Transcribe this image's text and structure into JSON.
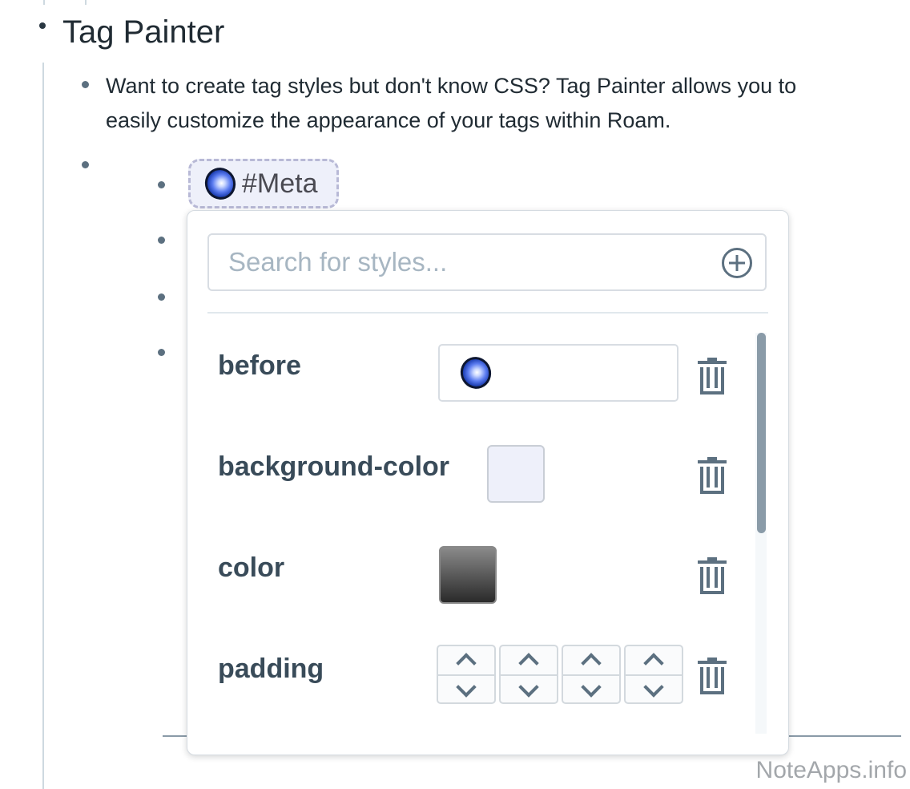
{
  "page": {
    "title": "Tag Painter",
    "description": "Want to create tag styles but don't know CSS? Tag Painter allows you to easily customize the appearance of your tags within Roam."
  },
  "tag": {
    "label": "#Meta",
    "icon": "nebula-icon"
  },
  "popover": {
    "search_placeholder": "Search for styles...",
    "add_icon": "plus-circle-icon",
    "rows": [
      {
        "label": "before",
        "control": "text",
        "value_icon": "nebula-icon"
      },
      {
        "label": "background-color",
        "control": "color",
        "color": "#eef0fa"
      },
      {
        "label": "color",
        "control": "color",
        "color": "#4a4a4a"
      },
      {
        "label": "padding",
        "control": "steppers",
        "stepper_count": 4
      }
    ],
    "delete_icon": "trash-icon"
  },
  "watermark": "NoteApps.info"
}
